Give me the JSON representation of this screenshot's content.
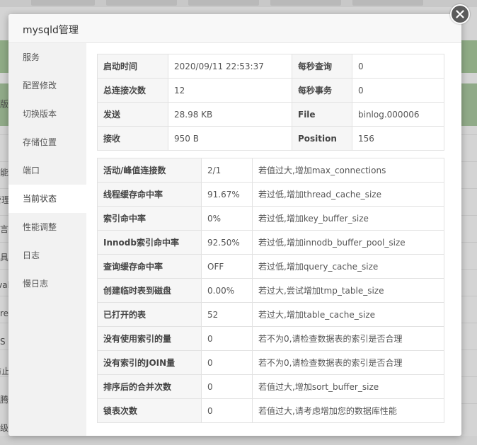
{
  "modal": {
    "title": "mysqld管理"
  },
  "sidebar": {
    "items": [
      {
        "label": "服务",
        "active": false
      },
      {
        "label": "配置修改",
        "active": false
      },
      {
        "label": "切换版本",
        "active": false
      },
      {
        "label": "存储位置",
        "active": false
      },
      {
        "label": "端口",
        "active": false
      },
      {
        "label": "当前状态",
        "active": true
      },
      {
        "label": "性能调整",
        "active": false
      },
      {
        "label": "日志",
        "active": false
      },
      {
        "label": "慢日志",
        "active": false
      }
    ]
  },
  "status": {
    "rows": [
      {
        "k1": "启动时间",
        "v1": "2020/09/11 22:53:37",
        "k2": "每秒查询",
        "v2": "0"
      },
      {
        "k1": "总连接次数",
        "v1": "12",
        "k2": "每秒事务",
        "v2": "0"
      },
      {
        "k1": "发送",
        "v1": "28.98 KB",
        "k2": "File",
        "v2": "binlog.000006"
      },
      {
        "k1": "接收",
        "v1": "950 B",
        "k2": "Position",
        "v2": "156"
      }
    ]
  },
  "performance": {
    "rows": [
      {
        "name": "活动/峰值连接数",
        "value": "2/1",
        "hint": "若值过大,增加max_connections"
      },
      {
        "name": "线程缓存命中率",
        "value": "91.67%",
        "hint": "若过低,增加thread_cache_size"
      },
      {
        "name": "索引命中率",
        "value": "0%",
        "hint": "若过低,增加key_buffer_size"
      },
      {
        "name": "Innodb索引命中率",
        "value": "92.50%",
        "hint": "若过低,增加innodb_buffer_pool_size"
      },
      {
        "name": "查询缓存命中率",
        "value": "OFF",
        "hint": "若过低,增加query_cache_size"
      },
      {
        "name": "创建临时表到磁盘",
        "value": "0.00%",
        "hint": "若过大,尝试增加tmp_table_size"
      },
      {
        "name": "已打开的表",
        "value": "52",
        "hint": "若过大,增加table_cache_size"
      },
      {
        "name": "没有使用索引的量",
        "value": "0",
        "hint": "若不为0,请检查数据表的索引是否合理"
      },
      {
        "name": "没有索引的JOIN量",
        "value": "0",
        "hint": "若不为0,请检查数据表的索引是否合理"
      },
      {
        "name": "排序后的合并次数",
        "value": "0",
        "hint": "若值过大,增加sort_buffer_size"
      },
      {
        "name": "锁表次数",
        "value": "0",
        "hint": "若值过大,请考虑增加您的数据库性能"
      }
    ]
  },
  "background": {
    "labels": [
      "版",
      "能",
      "管理",
      "言",
      "具",
      "val",
      "re",
      "S",
      "防止",
      "腾",
      "级"
    ]
  },
  "colors": {
    "sidebar_bg": "#f2f2f2",
    "close_button": "#5b5b5b",
    "key_cell_bg": "#f6f6f6"
  },
  "icons": {
    "close": "close-icon"
  }
}
